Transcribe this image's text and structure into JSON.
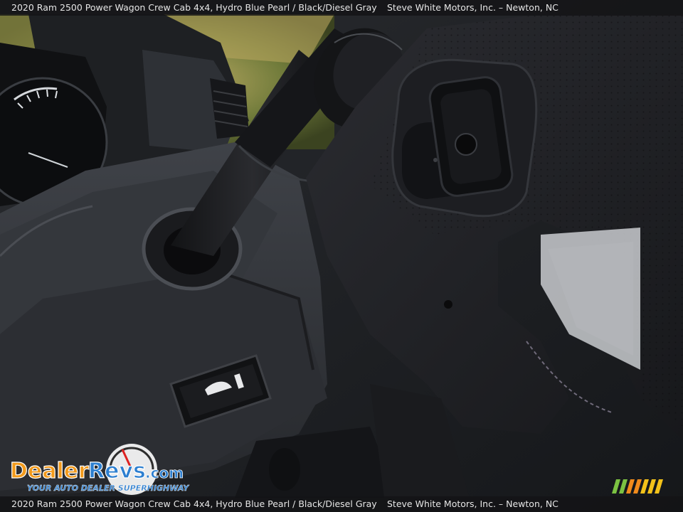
{
  "caption": {
    "vehicle": "2020 Ram 2500 Power Wagon Crew Cab 4x4,  Hydro Blue Pearl / Black/Diesel Gray",
    "dealer": "Steve White Motors, Inc.  –  Newton, NC"
  },
  "watermark": {
    "brand": "DealerRevs.com",
    "tagline": "Your Auto Dealer SuperHighway"
  },
  "colors": {
    "logo_orange": "#f29a1c",
    "logo_blue": "#2d7fd0",
    "stripe_green": "#7cc242",
    "stripe_yellow": "#f3c21a",
    "stripe_orange": "#f08a1c"
  }
}
